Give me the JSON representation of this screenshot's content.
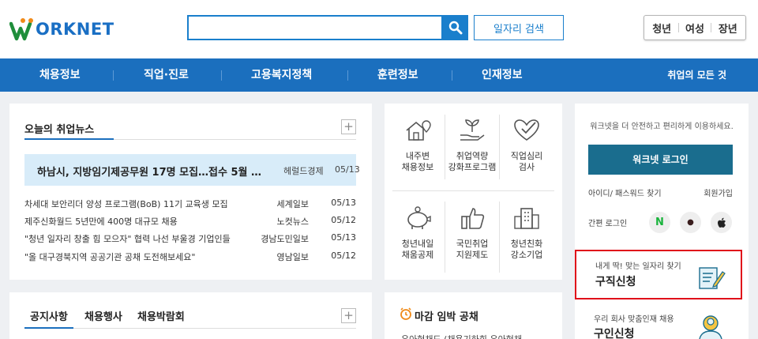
{
  "header": {
    "logo_text": "ORKNET",
    "search_placeholder": "",
    "job_search_label": "일자리 검색",
    "target_links": [
      "청년",
      "여성",
      "장년"
    ]
  },
  "gnb": {
    "items": [
      "채용정보",
      "직업·진로",
      "고용복지정책",
      "훈련정보",
      "인재정보"
    ],
    "all_label": "취업의 모든 것"
  },
  "news": {
    "title": "오늘의 취업뉴스",
    "headline": {
      "title": "하남시, 지방임기제공무원 17명 모집…접수 5월 …",
      "source": "헤럴드경제",
      "date": "05/13"
    },
    "items": [
      {
        "title": "차세대 보안리더 양성 프로그램(BoB) 11기 교육생 모집",
        "source": "세계일보",
        "date": "05/13"
      },
      {
        "title": "제주신화월드 5년만에 400명 대규모 채용",
        "source": "노컷뉴스",
        "date": "05/12"
      },
      {
        "title": "\"청년 일자리 창출 힘 모으자\" 협력 나선 부울경 기업인들",
        "source": "경남도민일보",
        "date": "05/13"
      },
      {
        "title": "\"올 대구경북지역 공공기관 공채 도전해보세요\"",
        "source": "영남일보",
        "date": "05/12"
      }
    ]
  },
  "notice": {
    "tabs": [
      "공지사항",
      "채용행사",
      "채용박람회"
    ]
  },
  "services": {
    "items": [
      {
        "line1": "내주변",
        "line2": "채용정보",
        "icon": "house-map-icon"
      },
      {
        "line1": "취업역량",
        "line2": "강화프로그램",
        "icon": "sprout-hand-icon"
      },
      {
        "line1": "직업심리",
        "line2": "검사",
        "icon": "heart-check-icon"
      },
      {
        "line1": "청년내일",
        "line2": "채움공제",
        "icon": "piggy-bank-icon"
      },
      {
        "line1": "국민취업",
        "line2": "지원제도",
        "icon": "thumbs-up-icon"
      },
      {
        "line1": "청년친화",
        "line2": "강소기업",
        "icon": "building-icon"
      }
    ]
  },
  "deadline": {
    "title": "마감 임박 공채",
    "sub": "유아현채드 (채용기하회 유아현채"
  },
  "side": {
    "message": "워크넷을 더 안전하고 편리하게 이용하세요.",
    "login_label": "워크넷 로그인",
    "find_id_label": "아이디/ 패스워드 찾기",
    "join_label": "회원가입",
    "easy_login_label": "간편 로그인",
    "easy_login_providers": [
      "N",
      "●",
      ""
    ],
    "job_apply_small": "내게 딱! 맞는 일자리 찾기",
    "job_apply_big": "구직신청",
    "recruit_small": "우리 회사 맞춤인재 채용",
    "recruit_big": "구인신청"
  },
  "colors": {
    "primary": "#1b6fbe",
    "login": "#1a6d8e",
    "highlight_border": "#e0101a",
    "headline_bg": "#d8ecf9"
  }
}
